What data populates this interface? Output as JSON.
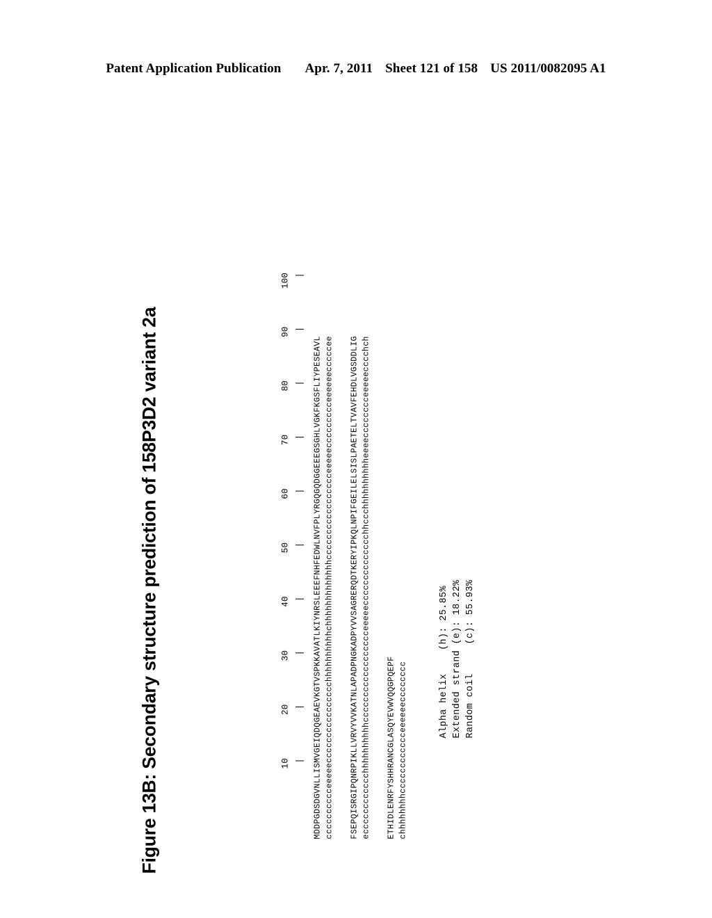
{
  "header": {
    "publication": "Patent Application Publication",
    "date": "Apr. 7, 2011",
    "sheet": "Sheet 121 of 158",
    "patent_number": "US 2011/0082095 A1"
  },
  "figure": {
    "title": "Figure 13B: Secondary structure prediction of 158P3D2 variant 2a",
    "ruler_numbers": "        10        20        30        40        50        60        70        80        90       100",
    "ruler_ticks": "         |         |         |         |         |         |         |         |         |         |",
    "blocks": [
      {
        "sequence": "MDDPGDSDGVNLLISMVGEIQDQGEAEVKGTVSPKKAVATLKIYNRSLEEEFNHFEDWLNVFPLYRGQGQDGGEEEGSGHLVGKFKGSFLIYPESEAVL",
        "structure": "cccccccccceeeeecccccccccccccccchhhhhhhhhhchhhhhhhhhhhhhccccccccccccccccceeeeeccccccccceeeeeecccccee"
      },
      {
        "sequence": "FSEPQISRGIPQNRPIKLLVRVYVVKATNLAPADPNGKADPYVVSAGRERQDTKERYIPKQLNPIFGEILELSISLPAETELTVAVFEHDLVGSDDLIG",
        "structure": "ecccccccccccchhhhhhhhhhcccccccccccccccccceeeeecccccccccccccchhccchhhhhhhhhheeeecccccccceeeeecccchch"
      },
      {
        "sequence": "ETHIDLENRFYSHHRANCGLASQYEVWVQQGPQEPF",
        "structure": "chhhhhhhhcccccccccccceeeeeecccccccc"
      }
    ],
    "stats": [
      {
        "label": "Alpha helix",
        "code": "(h):",
        "value": "25.85%"
      },
      {
        "label": "Extended strand",
        "code": "(e):",
        "value": "18.22%"
      },
      {
        "label": "Random coil",
        "code": "(c):",
        "value": "55.93%"
      }
    ]
  }
}
